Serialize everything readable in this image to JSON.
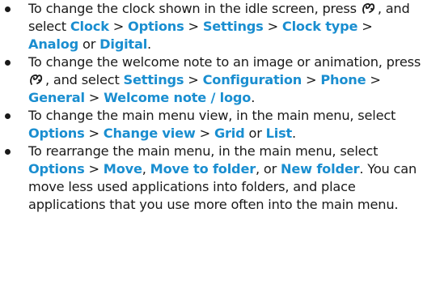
{
  "tips": [
    {
      "parts": [
        {
          "t": "To change the clock shown in the idle screen, press "
        },
        {
          "icon": "menu-key-icon"
        },
        {
          "t": ", and select "
        },
        {
          "h": "Clock"
        },
        {
          "t": " > "
        },
        {
          "h": "Options"
        },
        {
          "t": " > "
        },
        {
          "h": "Settings"
        },
        {
          "t": " > "
        },
        {
          "h": "Clock type"
        },
        {
          "t": " > "
        },
        {
          "h": "Analog"
        },
        {
          "t": " or "
        },
        {
          "h": "Digital"
        },
        {
          "t": "."
        }
      ]
    },
    {
      "parts": [
        {
          "t": "To change the welcome note to an image or animation, press "
        },
        {
          "icon": "menu-key-icon"
        },
        {
          "t": ", and select "
        },
        {
          "h": "Settings"
        },
        {
          "t": " > "
        },
        {
          "h": "Configuration"
        },
        {
          "t": " > "
        },
        {
          "h": "Phone"
        },
        {
          "t": " > "
        },
        {
          "h": "General"
        },
        {
          "t": " > "
        },
        {
          "h": "Welcome note / logo"
        },
        {
          "t": "."
        }
      ]
    },
    {
      "parts": [
        {
          "t": "To change the main menu view, in the main menu, select "
        },
        {
          "h": "Options"
        },
        {
          "t": " > "
        },
        {
          "h": "Change view"
        },
        {
          "t": " > "
        },
        {
          "h": "Grid"
        },
        {
          "t": " or "
        },
        {
          "h": "List"
        },
        {
          "t": "."
        }
      ]
    },
    {
      "parts": [
        {
          "t": "To rearrange the main menu, in the main menu, select "
        },
        {
          "h": "Options"
        },
        {
          "t": " > "
        },
        {
          "h": "Move"
        },
        {
          "t": ", "
        },
        {
          "h": "Move to folder"
        },
        {
          "t": ", or "
        },
        {
          "h": "New folder"
        },
        {
          "t": ". You can move less used applications into folders, and place applications that you use more often into the main menu."
        }
      ]
    }
  ],
  "colors": {
    "highlight": "#1a8ed0",
    "text": "#1a1a1a"
  }
}
